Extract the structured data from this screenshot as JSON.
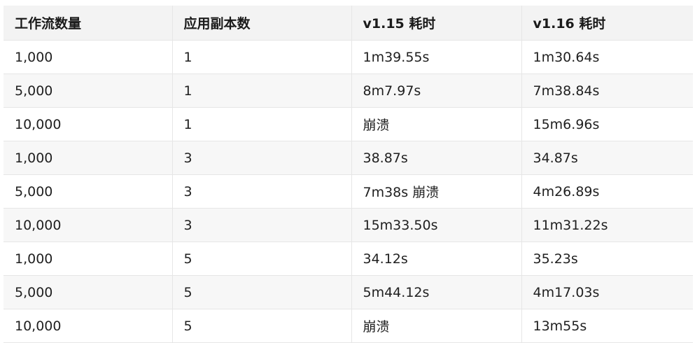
{
  "table": {
    "columns": [
      "工作流数量",
      "应用副本数",
      "v1.15 耗时",
      "v1.16 耗时"
    ],
    "rows": [
      [
        "1,000",
        "1",
        "1m39.55s",
        "1m30.64s"
      ],
      [
        "5,000",
        "1",
        "8m7.97s",
        "7m38.84s"
      ],
      [
        "10,000",
        "1",
        "崩溃",
        "15m6.96s"
      ],
      [
        "1,000",
        "3",
        "38.87s",
        "34.87s"
      ],
      [
        "5,000",
        "3",
        "7m38s 崩溃",
        "4m26.89s"
      ],
      [
        "10,000",
        "3",
        "15m33.50s",
        "11m31.22s"
      ],
      [
        "1,000",
        "5",
        "34.12s",
        "35.23s"
      ],
      [
        "5,000",
        "5",
        "5m44.12s",
        "4m17.03s"
      ],
      [
        "10,000",
        "5",
        "崩溃",
        "13m55s"
      ]
    ]
  },
  "chart_data": {
    "type": "table",
    "columns": [
      "工作流数量",
      "应用副本数",
      "v1.15 耗时",
      "v1.16 耗时"
    ],
    "rows": [
      [
        "1,000",
        "1",
        "1m39.55s",
        "1m30.64s"
      ],
      [
        "5,000",
        "1",
        "8m7.97s",
        "7m38.84s"
      ],
      [
        "10,000",
        "1",
        "崩溃",
        "15m6.96s"
      ],
      [
        "1,000",
        "3",
        "38.87s",
        "34.87s"
      ],
      [
        "5,000",
        "3",
        "7m38s 崩溃",
        "4m26.89s"
      ],
      [
        "10,000",
        "3",
        "15m33.50s",
        "11m31.22s"
      ],
      [
        "1,000",
        "5",
        "34.12s",
        "35.23s"
      ],
      [
        "5,000",
        "5",
        "5m44.12s",
        "4m17.03s"
      ],
      [
        "10,000",
        "5",
        "崩溃",
        "13m55s"
      ]
    ]
  }
}
